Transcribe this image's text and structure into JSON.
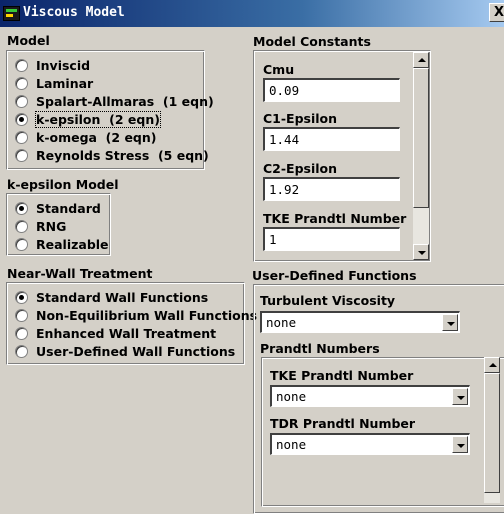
{
  "window": {
    "title": "Viscous Model",
    "close_label": "X"
  },
  "model": {
    "label": "Model",
    "options": [
      {
        "label": "Inviscid",
        "selected": false
      },
      {
        "label": "Laminar",
        "selected": false
      },
      {
        "label": "Spalart-Allmaras  (1 eqn)",
        "selected": false
      },
      {
        "label": "k-epsilon  (2 eqn)",
        "selected": true
      },
      {
        "label": "k-omega  (2 eqn)",
        "selected": false
      },
      {
        "label": "Reynolds Stress  (5 eqn)",
        "selected": false
      }
    ]
  },
  "kepsilon_model": {
    "label": "k-epsilon Model",
    "options": [
      {
        "label": "Standard",
        "selected": true
      },
      {
        "label": "RNG",
        "selected": false
      },
      {
        "label": "Realizable",
        "selected": false
      }
    ]
  },
  "near_wall": {
    "label": "Near-Wall Treatment",
    "options": [
      {
        "label": "Standard Wall Functions",
        "selected": true
      },
      {
        "label": "Non-Equilibrium Wall Functions",
        "selected": false
      },
      {
        "label": "Enhanced Wall Treatment",
        "selected": false
      },
      {
        "label": "User-Defined Wall Functions",
        "selected": false
      }
    ]
  },
  "model_constants": {
    "label": "Model Constants",
    "fields": [
      {
        "label": "Cmu",
        "value": "0.09"
      },
      {
        "label": "C1-Epsilon",
        "value": "1.44"
      },
      {
        "label": "C2-Epsilon",
        "value": "1.92"
      },
      {
        "label": "TKE Prandtl Number",
        "value": "1"
      }
    ]
  },
  "udf": {
    "label": "User-Defined Functions",
    "turbulent_viscosity": {
      "label": "Turbulent Viscosity",
      "value": "none"
    },
    "prandtl": {
      "label": "Prandtl Numbers",
      "tke": {
        "label": "TKE Prandtl Number",
        "value": "none"
      },
      "tdr": {
        "label": "TDR Prandtl Number",
        "value": "none"
      }
    }
  },
  "colors": {
    "titlebar": "#0a246a",
    "face": "#d4d0c8"
  }
}
